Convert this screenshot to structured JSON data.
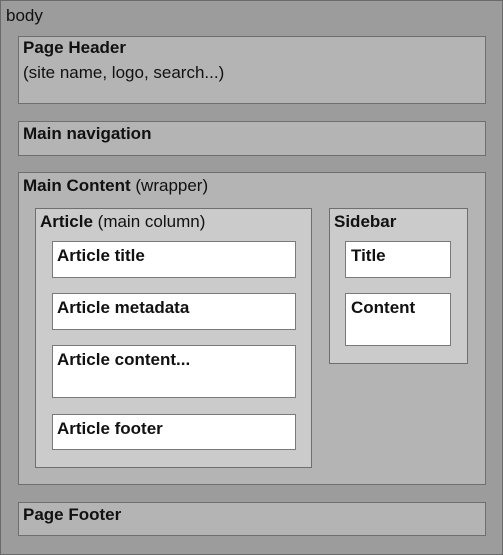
{
  "diagram": {
    "body_label": "body",
    "page_header": {
      "title": "Page Header",
      "subtitle": "(site name, logo, search...)"
    },
    "main_navigation": {
      "title": "Main navigation"
    },
    "main_content": {
      "title": "Main Content",
      "note": "(wrapper)",
      "article": {
        "title": "Article",
        "note": "(main column)",
        "items": [
          "Article title",
          "Article metadata",
          "Article content...",
          "Article footer"
        ]
      },
      "sidebar": {
        "title": "Sidebar",
        "items": [
          "Title",
          "Content"
        ]
      }
    },
    "page_footer": {
      "title": "Page Footer"
    }
  }
}
